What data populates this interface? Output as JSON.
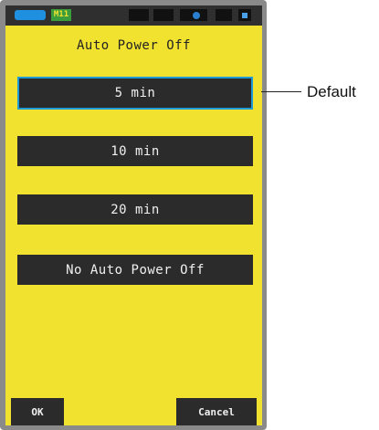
{
  "status": {
    "memory_label": "M11"
  },
  "screen": {
    "title": "Auto Power Off",
    "options": [
      {
        "label": "5 min",
        "selected": true
      },
      {
        "label": "10 min",
        "selected": false
      },
      {
        "label": "20 min",
        "selected": false
      },
      {
        "label": "No Auto Power Off",
        "selected": false
      }
    ],
    "ok_label": "OK",
    "cancel_label": "Cancel"
  },
  "annotation": {
    "default_label": "Default"
  },
  "colors": {
    "screen_bg": "#f2e230",
    "button_bg": "#2b2b2b",
    "selected_border": "#1e9ad6"
  }
}
